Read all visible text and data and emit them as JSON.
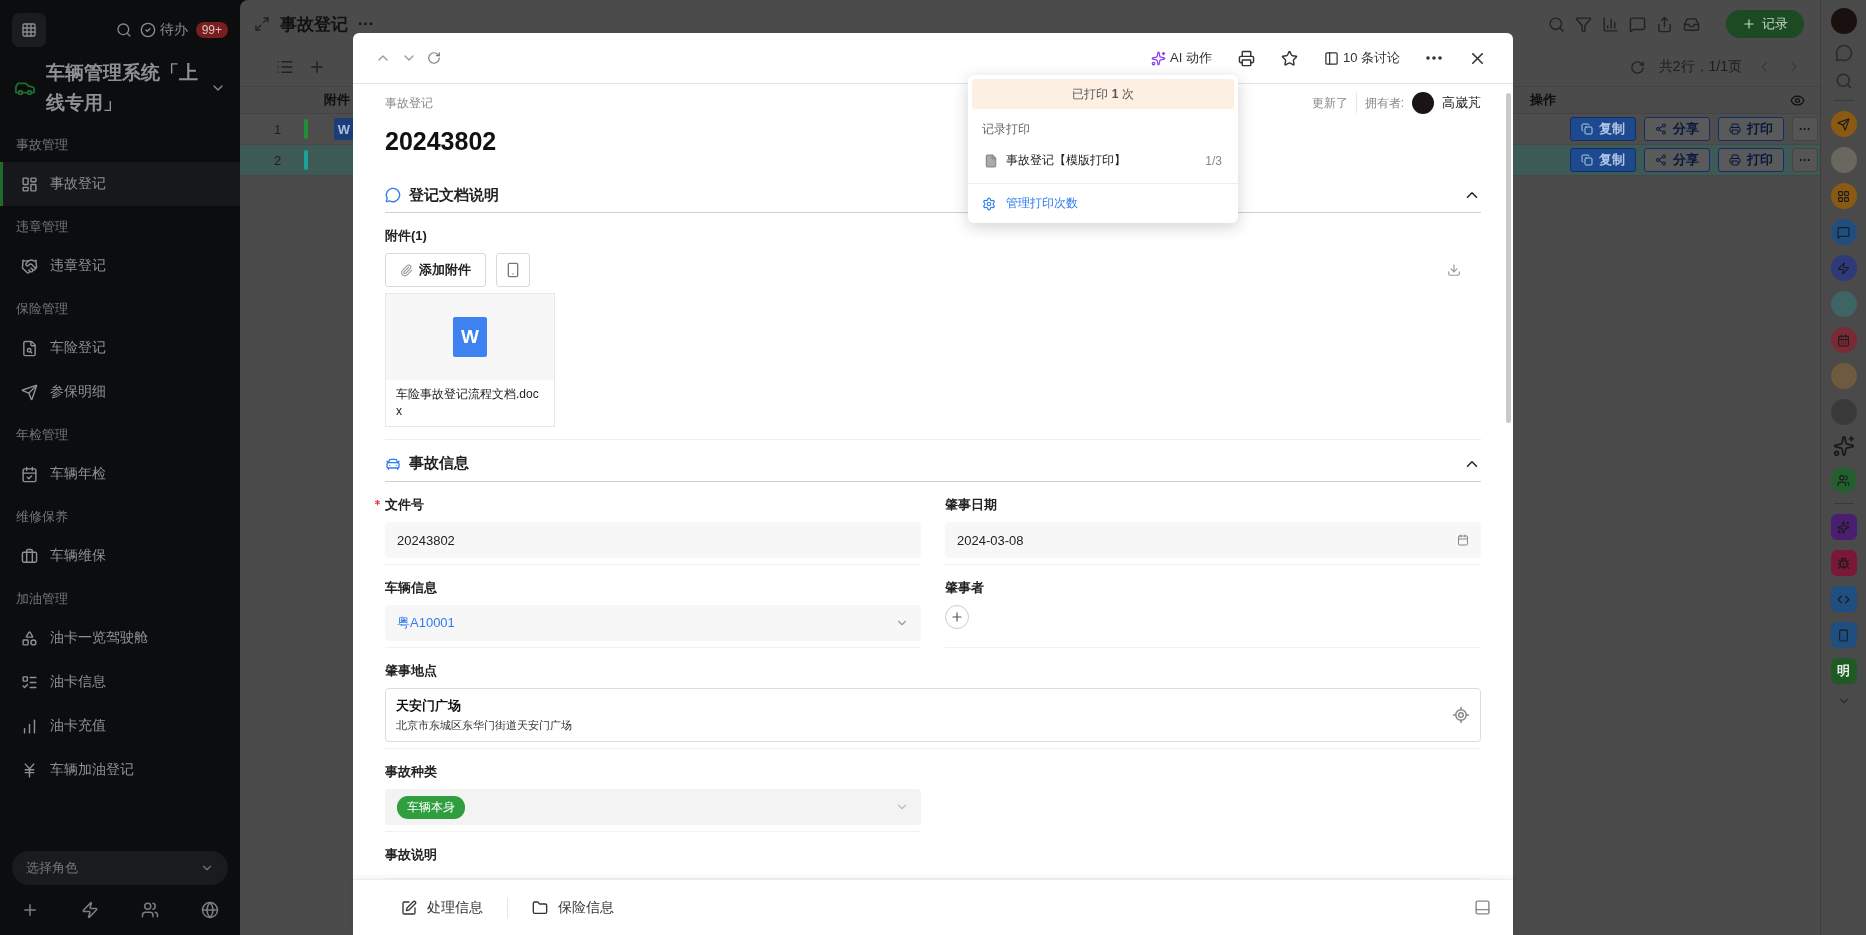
{
  "sidebar": {
    "todo_label": "待办",
    "todo_badge": "99+",
    "app_name": "车辆管理系统「上线专用」",
    "groups": [
      {
        "title": "事故管理",
        "items": [
          {
            "label": "事故登记",
            "selected": true
          }
        ]
      },
      {
        "title": "违章管理",
        "items": [
          {
            "label": "违章登记",
            "selected": false
          }
        ]
      },
      {
        "title": "保险管理",
        "items": [
          {
            "label": "车险登记",
            "selected": false
          },
          {
            "label": "参保明细",
            "selected": false
          }
        ]
      },
      {
        "title": "年检管理",
        "items": [
          {
            "label": "车辆年检",
            "selected": false
          }
        ]
      },
      {
        "title": "维修保养",
        "items": [
          {
            "label": "车辆维保",
            "selected": false
          }
        ]
      },
      {
        "title": "加油管理",
        "items": [
          {
            "label": "油卡一览驾驶舱",
            "selected": false
          },
          {
            "label": "油卡信息",
            "selected": false
          },
          {
            "label": "油卡充值",
            "selected": false
          },
          {
            "label": "车辆加油登记",
            "selected": false
          }
        ]
      }
    ],
    "role_select": {
      "placeholder": "选择角色"
    }
  },
  "main": {
    "title": "事故登记",
    "more": "···",
    "record_button": "记录",
    "pagination": "共2行，1/1页",
    "columns": [
      "附件",
      "操作"
    ],
    "rows": [
      {
        "index": "1",
        "color": "#1f8f3a",
        "selected": false,
        "attachment_glyph": "W",
        "actions": [
          "复制",
          "分享",
          "打印"
        ],
        "more": "···"
      },
      {
        "index": "2",
        "color": "#17a398",
        "selected": true,
        "actions": [
          "复制",
          "分享",
          "打印"
        ],
        "more": "···"
      }
    ]
  },
  "modal": {
    "ai_label": "AI 动作",
    "discussion": "10 条讨论",
    "breadcrumb": "事故登记",
    "title": "20243802",
    "updated": "更新了",
    "owner_label": "拥有者:",
    "owner": "高崴芃",
    "sections": [
      {
        "title": "登记文档说明",
        "expanded": true
      },
      {
        "title": "事故信息",
        "expanded": true
      }
    ],
    "attachment": {
      "label": "附件(1)",
      "add_button": "添加附件",
      "file_glyph": "W",
      "file_name": "车险事故登记流程文档.docx"
    },
    "fields": [
      {
        "kind": "text",
        "label": "文件号",
        "required": true,
        "value": "20243802"
      },
      {
        "kind": "date",
        "label": "肇事日期",
        "required": false,
        "value": "2024-03-08"
      },
      {
        "kind": "link",
        "label": "车辆信息",
        "required": false,
        "value": "粤A10001"
      },
      {
        "kind": "person",
        "label": "肇事者",
        "required": false
      },
      {
        "kind": "location",
        "label": "肇事地点",
        "required": false,
        "value": "天安门广场",
        "address": "北京市东城区东华门街道天安门广场"
      },
      {
        "kind": "tag",
        "label": "事故种类",
        "required": false,
        "value": "车辆本身"
      },
      {
        "kind": "label",
        "label": "事故说明",
        "required": false
      }
    ],
    "bottom_tabs": [
      "处理信息",
      "保险信息"
    ]
  },
  "print_menu": {
    "status": "已打印 **1** 次",
    "section": "记录打印",
    "items": [
      {
        "label": "事故登记【模版打印】",
        "count": "1/3"
      }
    ],
    "manage": "管理打印次数"
  },
  "rail": {
    "app_glyph": "明"
  }
}
